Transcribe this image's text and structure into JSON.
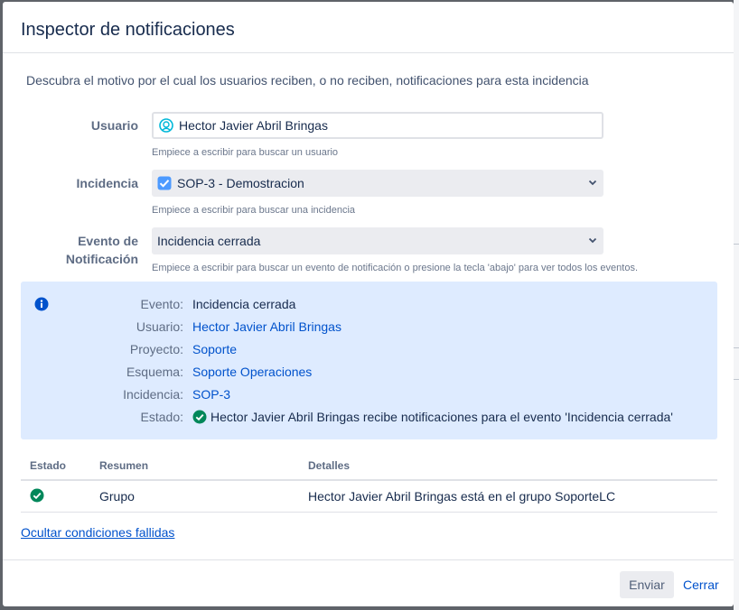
{
  "dialog": {
    "title": "Inspector de notificaciones",
    "intro": "Descubra el motivo por el cual los usuarios reciben, o no reciben, notificaciones para esta incidencia"
  },
  "form": {
    "user": {
      "label": "Usuario",
      "value": "Hector Javier Abril Bringas",
      "hint": "Empiece a escribir para buscar un usuario"
    },
    "issue": {
      "label": "Incidencia",
      "value": "SOP-3 - Demostracion",
      "hint": "Empiece a escribir para buscar una incidencia"
    },
    "event": {
      "label_line1": "Evento de",
      "label_line2": "Notificación",
      "value": "Incidencia cerrada",
      "hint": "Empiece a escribir para buscar un evento de notificación o presione la tecla 'abajo' para ver todos los eventos."
    }
  },
  "info": {
    "rows": [
      {
        "key": "Evento:",
        "value": "Incidencia cerrada"
      },
      {
        "key": "Usuario:",
        "value": "Hector Javier Abril Bringas"
      },
      {
        "key": "Proyecto:",
        "value": "Soporte"
      },
      {
        "key": "Esquema:",
        "value": "Soporte Operaciones"
      },
      {
        "key": "Incidencia:",
        "value": "SOP-3"
      },
      {
        "key": "Estado:",
        "value": "Hector Javier Abril Bringas recibe notificaciones para el evento 'Incidencia cerrada'"
      }
    ]
  },
  "table": {
    "headers": [
      "Estado",
      "Resumen",
      "Detalles"
    ],
    "rows": [
      {
        "summary": "Grupo",
        "details": "Hector Javier Abril Bringas está en el grupo SoporteLC"
      }
    ]
  },
  "toggle_link": "Ocultar condiciones fallidas",
  "footer": {
    "send": "Enviar",
    "close": "Cerrar"
  },
  "colors": {
    "accent": "#0052cc",
    "info_bg": "#deebff",
    "success": "#00875a"
  }
}
